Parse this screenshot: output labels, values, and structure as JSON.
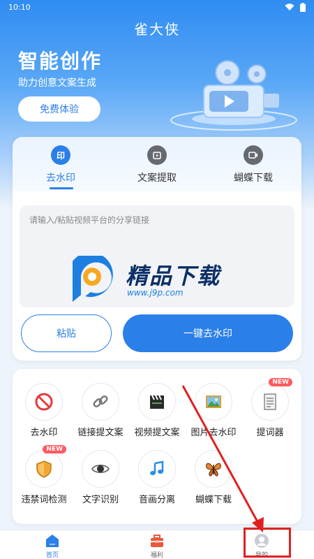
{
  "status_bar": {
    "time": "10:10"
  },
  "app": {
    "title": "雀大侠"
  },
  "hero": {
    "title": "智能创作",
    "subtitle": "助力创意文案生成",
    "button_label": "免费体验"
  },
  "tabs": [
    {
      "label": "去水印",
      "icon": "watermark-stamp-icon",
      "active": true
    },
    {
      "label": "文案提取",
      "icon": "copy-extract-icon",
      "active": false
    },
    {
      "label": "蝴蝶下载",
      "icon": "video-download-icon",
      "active": false
    }
  ],
  "input": {
    "placeholder": "请输入/粘贴视频平台的分享链接"
  },
  "watermark_logo": {
    "text": "精品下载",
    "url_text": "www.j9p.com"
  },
  "actions": {
    "paste_label": "粘贴",
    "remove_label": "一键去水印"
  },
  "tools": [
    {
      "label": "去水印",
      "icon": "no-entry-icon",
      "badge": ""
    },
    {
      "label": "链接提文案",
      "icon": "link-icon",
      "badge": ""
    },
    {
      "label": "视频提文案",
      "icon": "clapperboard-icon",
      "badge": ""
    },
    {
      "label": "图片去水印",
      "icon": "picture-icon",
      "badge": ""
    },
    {
      "label": "提词器",
      "icon": "document-icon",
      "badge": "NEW"
    },
    {
      "label": "违禁词检测",
      "icon": "shield-icon",
      "badge": "NEW"
    },
    {
      "label": "文字识别",
      "icon": "eye-icon",
      "badge": ""
    },
    {
      "label": "音画分离",
      "icon": "music-note-icon",
      "badge": ""
    },
    {
      "label": "蝴蝶下载",
      "icon": "butterfly-icon",
      "badge": ""
    }
  ],
  "bottom_nav": [
    {
      "label": "首页",
      "icon": "home-icon",
      "active": true
    },
    {
      "label": "福利",
      "icon": "gift-toolbox-icon",
      "active": false
    },
    {
      "label": "我的",
      "icon": "profile-icon",
      "active": false
    }
  ],
  "colors": {
    "accent": "#2b7fe8",
    "badge": "#ff5a5f",
    "annotation": "#e02020"
  }
}
